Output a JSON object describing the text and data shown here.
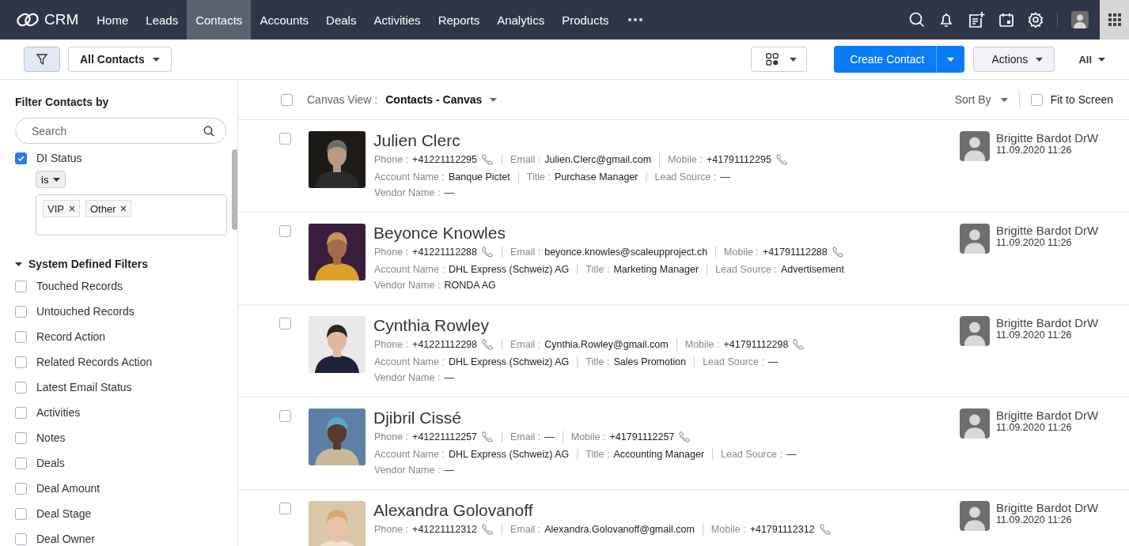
{
  "app": {
    "name": "CRM"
  },
  "nav": [
    {
      "label": "Home",
      "selected": false
    },
    {
      "label": "Leads",
      "selected": false
    },
    {
      "label": "Contacts",
      "selected": true
    },
    {
      "label": "Accounts",
      "selected": false
    },
    {
      "label": "Deals",
      "selected": false
    },
    {
      "label": "Activities",
      "selected": false
    },
    {
      "label": "Reports",
      "selected": false
    },
    {
      "label": "Analytics",
      "selected": false
    },
    {
      "label": "Products",
      "selected": false
    }
  ],
  "toolbar": {
    "filter_button": {
      "selected": true
    },
    "view_selector": {
      "label": "All Contacts"
    },
    "create_button": {
      "label": "Create Contact"
    },
    "actions_button": {
      "label": "Actions"
    },
    "scope_menu": {
      "label": "All"
    }
  },
  "sidebar": {
    "title": "Filter Contacts by",
    "search": {
      "placeholder": "Search"
    },
    "applied_filter": {
      "label": "DI Status",
      "checked": true,
      "operator": "is",
      "values": [
        "VIP",
        "Other"
      ]
    },
    "section": {
      "title": "System Defined Filters",
      "expanded": true,
      "items": [
        {
          "label": "Touched Records",
          "checked": false
        },
        {
          "label": "Untouched Records",
          "checked": false
        },
        {
          "label": "Record Action",
          "checked": false
        },
        {
          "label": "Related Records Action",
          "checked": false
        },
        {
          "label": "Latest Email Status",
          "checked": false
        },
        {
          "label": "Activities",
          "checked": false
        },
        {
          "label": "Notes",
          "checked": false
        },
        {
          "label": "Deals",
          "checked": false
        },
        {
          "label": "Deal Amount",
          "checked": false
        },
        {
          "label": "Deal Stage",
          "checked": false
        },
        {
          "label": "Deal Owner",
          "checked": false
        }
      ]
    }
  },
  "list_header": {
    "select_all": {
      "checked": false
    },
    "view_label": "Canvas View :",
    "view_name": "Contacts - Canvas",
    "sort_label": "Sort By",
    "fit_to_screen": {
      "label": "Fit to Screen",
      "checked": false
    }
  },
  "records": [
    {
      "name": "Julien Clerc",
      "checked": false,
      "owner": {
        "name": "Brigitte Bardot DrW",
        "time": "11.09.2020 11:26"
      },
      "lines": [
        [
          {
            "label": "Phone :",
            "value": "+41221112295",
            "kind": "phone"
          },
          {
            "label": "Email :",
            "value": "Julien.Clerc@gmail.com",
            "kind": "text"
          },
          {
            "label": "Mobile :",
            "value": "+41791112295",
            "kind": "phone"
          }
        ],
        [
          {
            "label": "Account Name :",
            "value": "Banque Pictet",
            "kind": "text"
          },
          {
            "label": "Title :",
            "value": "Purchase Manager",
            "kind": "text"
          },
          {
            "label": "Lead Source :",
            "value": "—",
            "kind": "text"
          }
        ],
        [
          {
            "label": "Vendor Name :",
            "value": "—",
            "kind": "text"
          }
        ]
      ]
    },
    {
      "name": "Beyonce Knowles",
      "checked": false,
      "owner": {
        "name": "Brigitte Bardot DrW",
        "time": "11.09.2020 11:26"
      },
      "lines": [
        [
          {
            "label": "Phone :",
            "value": "+41221112288",
            "kind": "phone"
          },
          {
            "label": "Email :",
            "value": "beyonce.knowles@scaleupproject.ch",
            "kind": "text"
          },
          {
            "label": "Mobile :",
            "value": "+41791112288",
            "kind": "phone"
          }
        ],
        [
          {
            "label": "Account Name :",
            "value": "DHL Express (Schweiz) AG",
            "kind": "text"
          },
          {
            "label": "Title :",
            "value": "Marketing Manager",
            "kind": "text"
          },
          {
            "label": "Lead Source :",
            "value": "Advertisement",
            "kind": "text"
          }
        ],
        [
          {
            "label": "Vendor Name :",
            "value": "RONDA AG",
            "kind": "text"
          }
        ]
      ]
    },
    {
      "name": "Cynthia Rowley",
      "checked": false,
      "owner": {
        "name": "Brigitte Bardot DrW",
        "time": "11.09.2020 11:26"
      },
      "lines": [
        [
          {
            "label": "Phone :",
            "value": "+41221112298",
            "kind": "phone"
          },
          {
            "label": "Email :",
            "value": "Cynthia.Rowley@gmail.com",
            "kind": "text"
          },
          {
            "label": "Mobile :",
            "value": "+41791112298",
            "kind": "phone"
          }
        ],
        [
          {
            "label": "Account Name :",
            "value": "DHL Express (Schweiz) AG",
            "kind": "text"
          },
          {
            "label": "Title :",
            "value": "Sales Promotion",
            "kind": "text"
          },
          {
            "label": "Lead Source :",
            "value": "—",
            "kind": "text"
          }
        ],
        [
          {
            "label": "Vendor Name :",
            "value": "—",
            "kind": "text"
          }
        ]
      ]
    },
    {
      "name": "Djibril Cissé",
      "checked": false,
      "owner": {
        "name": "Brigitte Bardot DrW",
        "time": "11.09.2020 11:26"
      },
      "lines": [
        [
          {
            "label": "Phone :",
            "value": "+41221112257",
            "kind": "phone"
          },
          {
            "label": "Email :",
            "value": "—",
            "kind": "text"
          },
          {
            "label": "Mobile :",
            "value": "+41791112257",
            "kind": "phone"
          }
        ],
        [
          {
            "label": "Account Name :",
            "value": "DHL Express (Schweiz) AG",
            "kind": "text"
          },
          {
            "label": "Title :",
            "value": "Accounting Manager",
            "kind": "text"
          },
          {
            "label": "Lead Source :",
            "value": "—",
            "kind": "text"
          }
        ],
        [
          {
            "label": "Vendor Name :",
            "value": "—",
            "kind": "text"
          }
        ]
      ]
    },
    {
      "name": "Alexandra Golovanoff",
      "checked": false,
      "owner": {
        "name": "Brigitte Bardot DrW",
        "time": "11.09.2020 11:26"
      },
      "lines": [
        [
          {
            "label": "Phone :",
            "value": "+41221112312",
            "kind": "phone"
          },
          {
            "label": "Email :",
            "value": "Alexandra.Golovanoff@gmail.com",
            "kind": "text"
          },
          {
            "label": "Mobile :",
            "value": "+41791112312",
            "kind": "phone"
          }
        ]
      ]
    }
  ]
}
